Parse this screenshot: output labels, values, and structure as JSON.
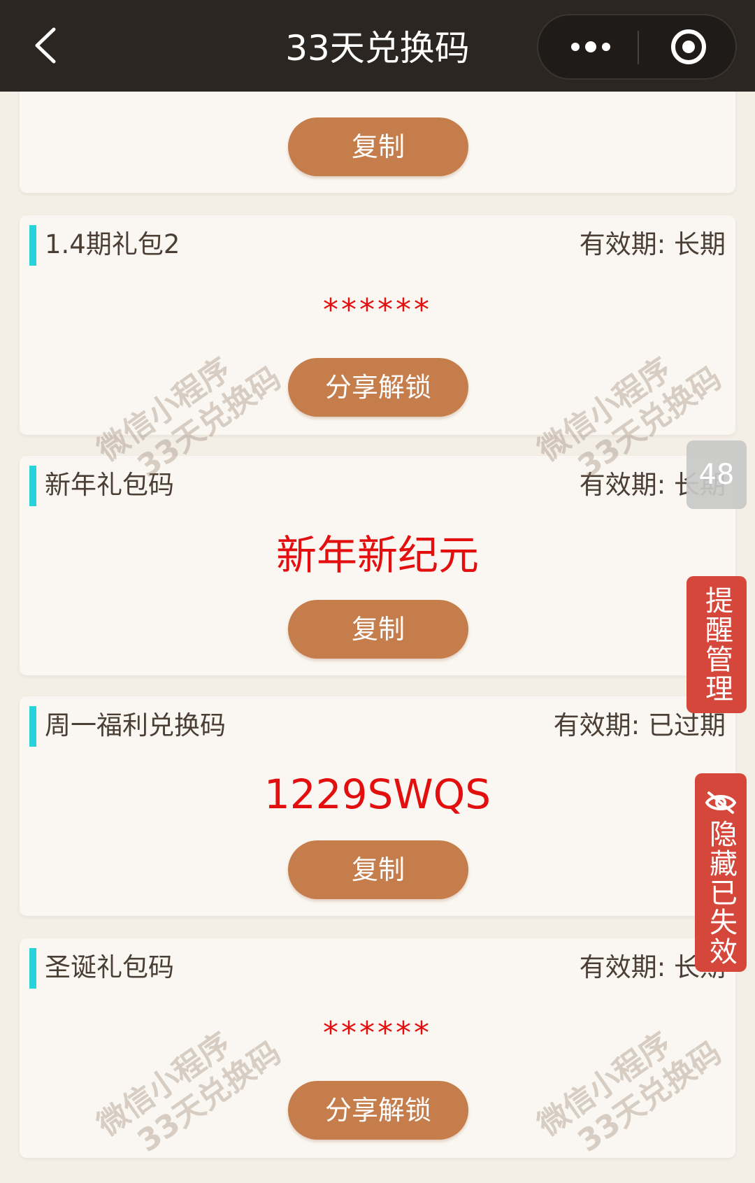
{
  "header": {
    "title": "33天兑换码",
    "back_icon": "chevron-left-icon",
    "more_icon": "more-dots-icon",
    "close_icon": "target-close-icon"
  },
  "watermark": {
    "line1": "微信小程序",
    "line2": "33天兑换码"
  },
  "cards": [
    {
      "button_label": "复制"
    },
    {
      "title": "1.4期礼包2",
      "validity": "有效期: 长期",
      "code": "******",
      "button_label": "分享解锁"
    },
    {
      "title": "新年礼包码",
      "validity": "有效期: 长期",
      "code": "新年新纪元",
      "button_label": "复制"
    },
    {
      "title": "周一福利兑换码",
      "validity": "有效期: 已过期",
      "code": "1229SWQS",
      "button_label": "复制"
    },
    {
      "title": "圣诞礼包码",
      "validity": "有效期: 长期",
      "code": "******",
      "button_label": "分享解锁"
    }
  ],
  "floating": {
    "count": "48",
    "remind_label": "提醒管理",
    "hide_label": "隐藏已失效",
    "hide_icon": "eye-off-icon"
  },
  "colors": {
    "header_bg": "#2b2621",
    "page_bg": "#f3eee6",
    "card_bg": "#faf7f2",
    "accent_bar": "#27d3d8",
    "button": "#c57d4c",
    "code_red": "#e30e0e",
    "side_button_red": "#d6473b"
  }
}
